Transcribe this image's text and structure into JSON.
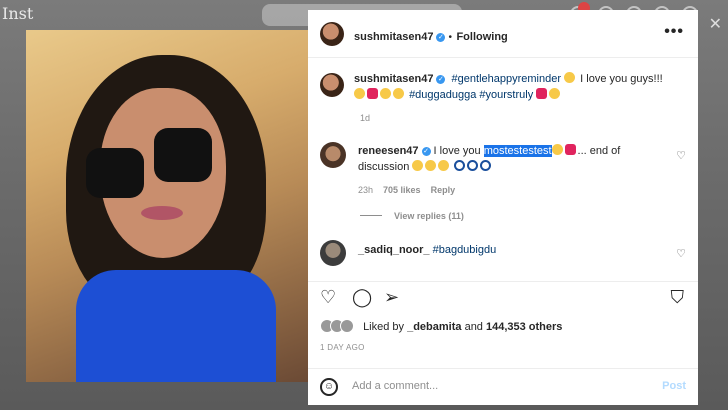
{
  "background": {
    "logo_text": "Inst"
  },
  "post": {
    "author": "sushmitasen47",
    "follow_status": "Following",
    "more_glyph": "•••",
    "caption_user": "sushmitasen47",
    "caption_line1": "#gentlehappyreminder",
    "caption_line1_tail": "I love you guys!!!",
    "caption_line2": "#duggadugga #yourstruly",
    "caption_age": "1d"
  },
  "comments": [
    {
      "user": "reneesen47",
      "text_before": "I love you ",
      "text_selected": "mostestestest",
      "text_after": "... end of",
      "text_line2": "discussion",
      "time": "23h",
      "likes": "705 likes",
      "reply": "Reply",
      "view_replies": "View replies (11)"
    },
    {
      "user": "_sadiq_noor_",
      "text": "#bagdubigdu"
    }
  ],
  "likes_text_prefix": "Liked by ",
  "likes_user": "_debamita",
  "likes_text_mid": " and ",
  "likes_count": "144,353 others",
  "posted_ago": "1 DAY AGO",
  "comment_input": {
    "placeholder": "Add a comment...",
    "post_label": "Post"
  },
  "colors": {
    "link_blue": "#00376b",
    "verified_blue": "#3897f0",
    "selection_blue": "#1a73e8"
  }
}
